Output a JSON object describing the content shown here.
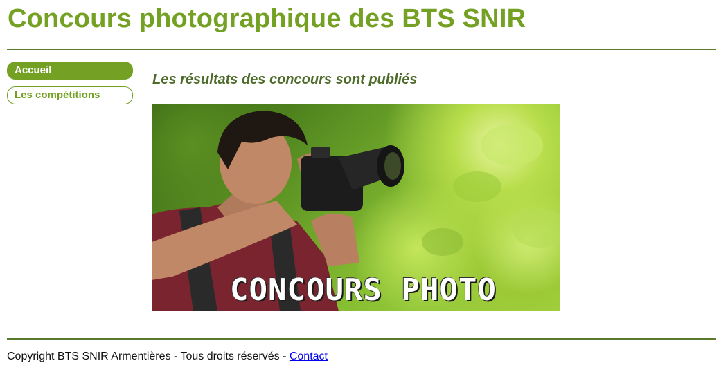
{
  "header": {
    "title": "Concours photographique des BTS SNIR"
  },
  "nav": {
    "items": [
      {
        "label": "Accueil",
        "active": true
      },
      {
        "label": "Les compétitions",
        "active": false
      }
    ]
  },
  "main": {
    "headline": "Les résultats des concours sont publiés",
    "banner": {
      "caption": "CONCOURS PHOTO"
    }
  },
  "footer": {
    "copyright": "Copyright BTS SNIR Armentières - Tous droits réservés - ",
    "contact_link": "Contact"
  },
  "colors": {
    "accent": "#74a124",
    "heading": "#4e6b2a",
    "rule": "#5a7a2e",
    "link": "#0000ee"
  },
  "icons": [
    "camera-icon"
  ]
}
